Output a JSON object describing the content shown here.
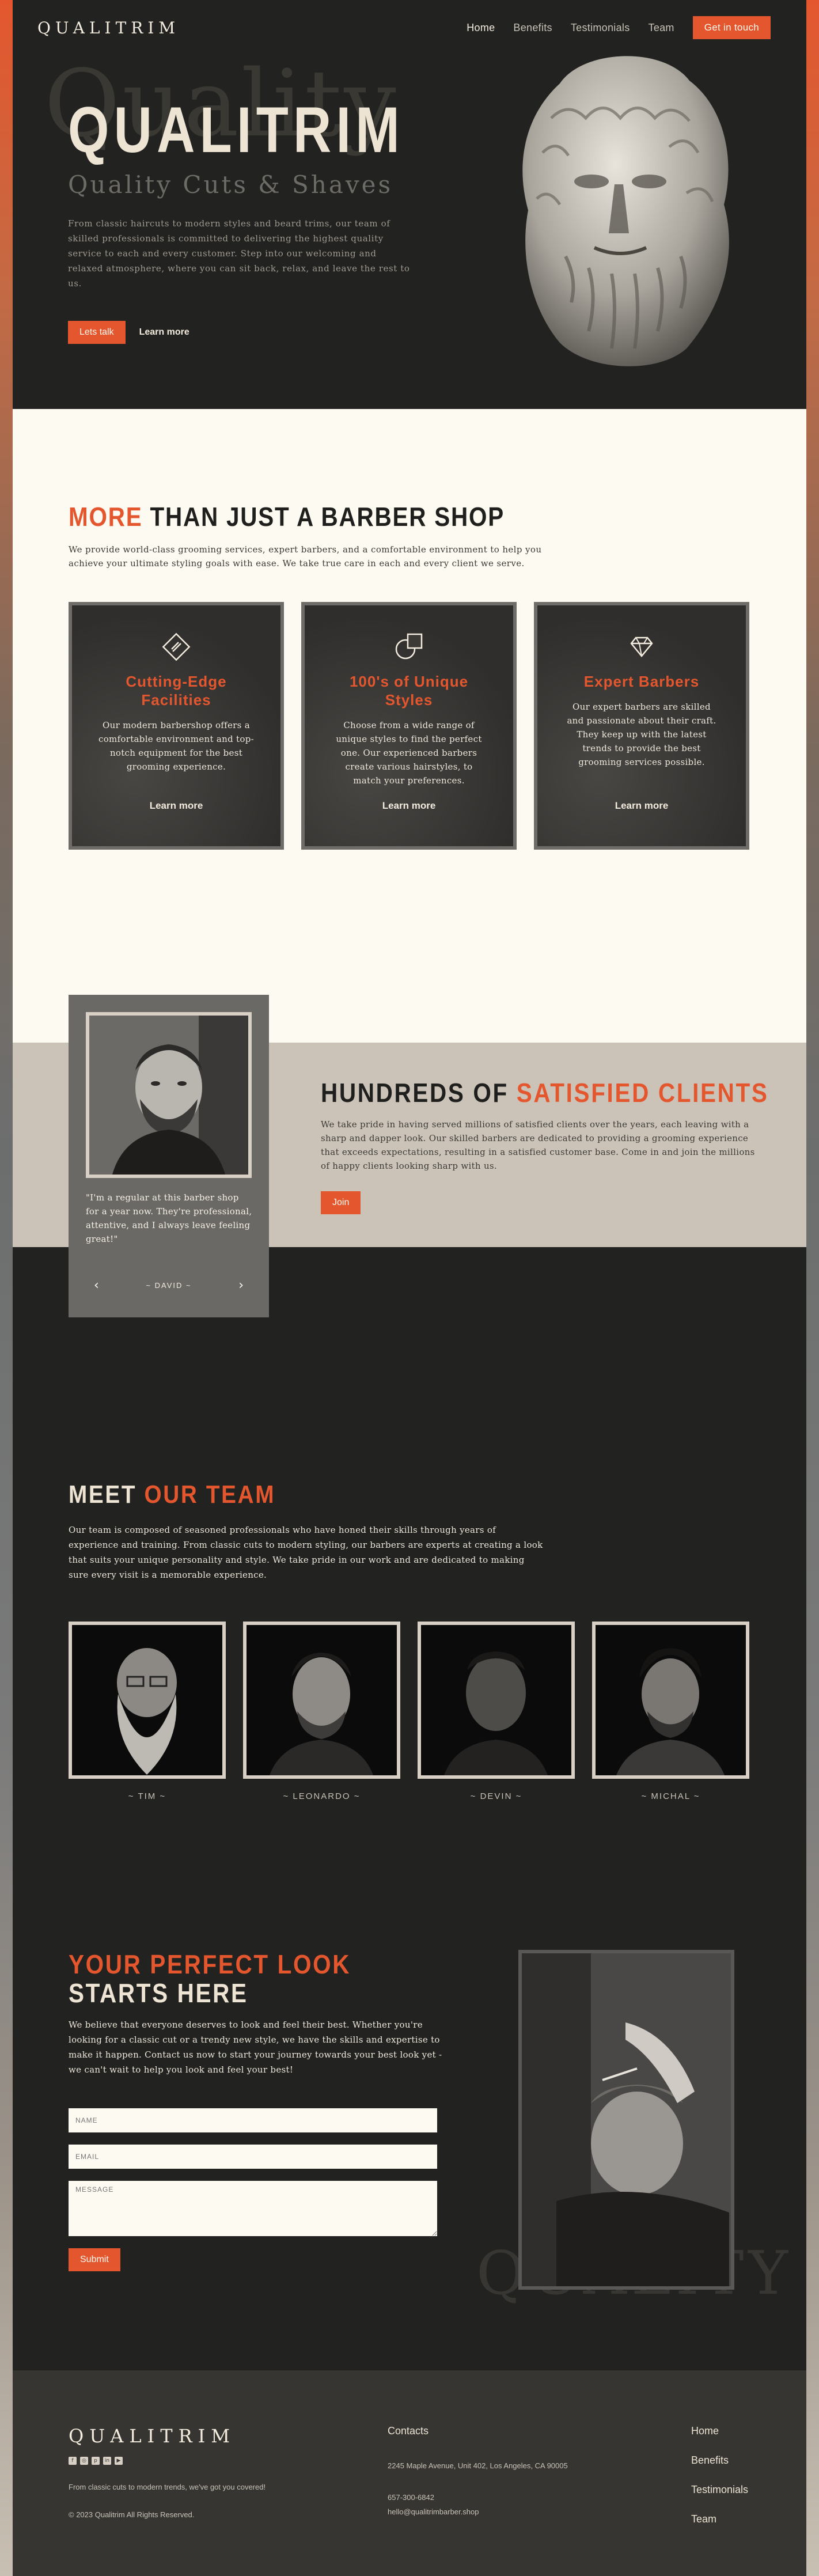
{
  "brand": {
    "name": "QUALITRIM",
    "accent": "#e4572e",
    "dark": "#222220",
    "cream": "#fdfaf1"
  },
  "nav": {
    "items": [
      {
        "label": "Home",
        "active": true
      },
      {
        "label": "Benefits"
      },
      {
        "label": "Testimonials"
      },
      {
        "label": "Team"
      }
    ],
    "cta": "Get in touch"
  },
  "hero": {
    "ghost": "Quality",
    "title": "QUALITRIM",
    "subtitle": "Quality Cuts & Shaves",
    "text": "From classic haircuts to modern styles and beard trims, our team of skilled professionals is committed to delivering the highest quality service to each and every customer. Step into our welcoming and relaxed atmosphere, where you can sit back, relax, and leave the rest to us.",
    "primary_button": "Lets talk",
    "secondary_button": "Learn more"
  },
  "about": {
    "title_accent": "MORE",
    "title_rest": " THAN JUST A BARBER SHOP",
    "text": "We provide world-class grooming services, expert barbers, and a comfortable environment to help you achieve your ultimate styling goals with ease. We take true care in each and every client we serve.",
    "cards": [
      {
        "icon": "comb-diamond-icon",
        "title": "Cutting-Edge Facilities",
        "text": "Our modern barbershop offers a comfortable environment and top-notch equipment for the best grooming experience.",
        "link": "Learn more"
      },
      {
        "icon": "style-shapes-icon",
        "title": "100's of Unique Styles",
        "text": "Choose from a wide range of unique styles to find the perfect one. Our experienced barbers create various hairstyles, to match your preferences.",
        "link": "Learn more"
      },
      {
        "icon": "diamond-icon",
        "title": "Expert Barbers",
        "text": "Our expert barbers are skilled and passionate about their craft. They keep up with the latest trends to provide the best grooming services possible.",
        "link": "Learn more"
      }
    ]
  },
  "testimonials": {
    "title_rest": "HUNDREDS OF ",
    "title_accent": "SATISFIED CLIENTS",
    "text": "We take pride in having served millions of satisfied clients over the years, each leaving with a sharp and dapper look. Our skilled barbers are dedicated to providing a grooming experience that exceeds expectations, resulting in a satisfied customer base. Come in and join the millions of happy clients looking sharp with us.",
    "button": "Join",
    "quote": "\"I'm a regular at this barber shop for a year now. They're professional, attentive, and I always leave feeling great!\"",
    "author": "~ DAVID ~",
    "prev": "‹",
    "next": "›"
  },
  "team": {
    "title_rest": "MEET ",
    "title_accent": "OUR TEAM",
    "text": "Our team is composed of seasoned professionals who have honed their skills through years of experience and training. From classic cuts to modern styling, our barbers are experts at creating a look that suits your unique personality and style. We take pride in our work and are dedicated to making sure every visit is a memorable experience.",
    "members": [
      {
        "name": "~ TIM ~"
      },
      {
        "name": "~ LEONARDO ~"
      },
      {
        "name": "~ DEVIN ~"
      },
      {
        "name": "~ MICHAL ~"
      }
    ]
  },
  "contact": {
    "title_accent": "YOUR PERFECT LOOK",
    "title_rest": " STARTS HERE",
    "text": "We believe that everyone deserves to look and feel their best. Whether you're looking for a classic cut or a trendy new style, we have the skills and expertise to make it happen. Contact us now to start your journey towards your best look yet - we can't wait to help you look and feel your best!",
    "name_placeholder": "NAME",
    "email_placeholder": "EMAIL",
    "message_placeholder": "MESSAGE",
    "submit": "Submit",
    "ghost": "QUALITY"
  },
  "footer": {
    "logo": "QUALITRIM",
    "socials": [
      "facebook-icon",
      "instagram-icon",
      "pinterest-icon",
      "linkedin-icon",
      "youtube-icon"
    ],
    "tagline": "From classic cuts to modern trends, we've got you covered!",
    "copyright": "© 2023 Qualitrim All Rights Reserved.",
    "contacts_heading": "Contacts",
    "address": "2245 Maple Avenue, Unit 402, Los Angeles, CA 90005",
    "phone": "657-300-6842",
    "email": "hello@qualitrimbarber.shop",
    "links": [
      "Home",
      "Benefits",
      "Testimonials",
      "Team"
    ]
  }
}
